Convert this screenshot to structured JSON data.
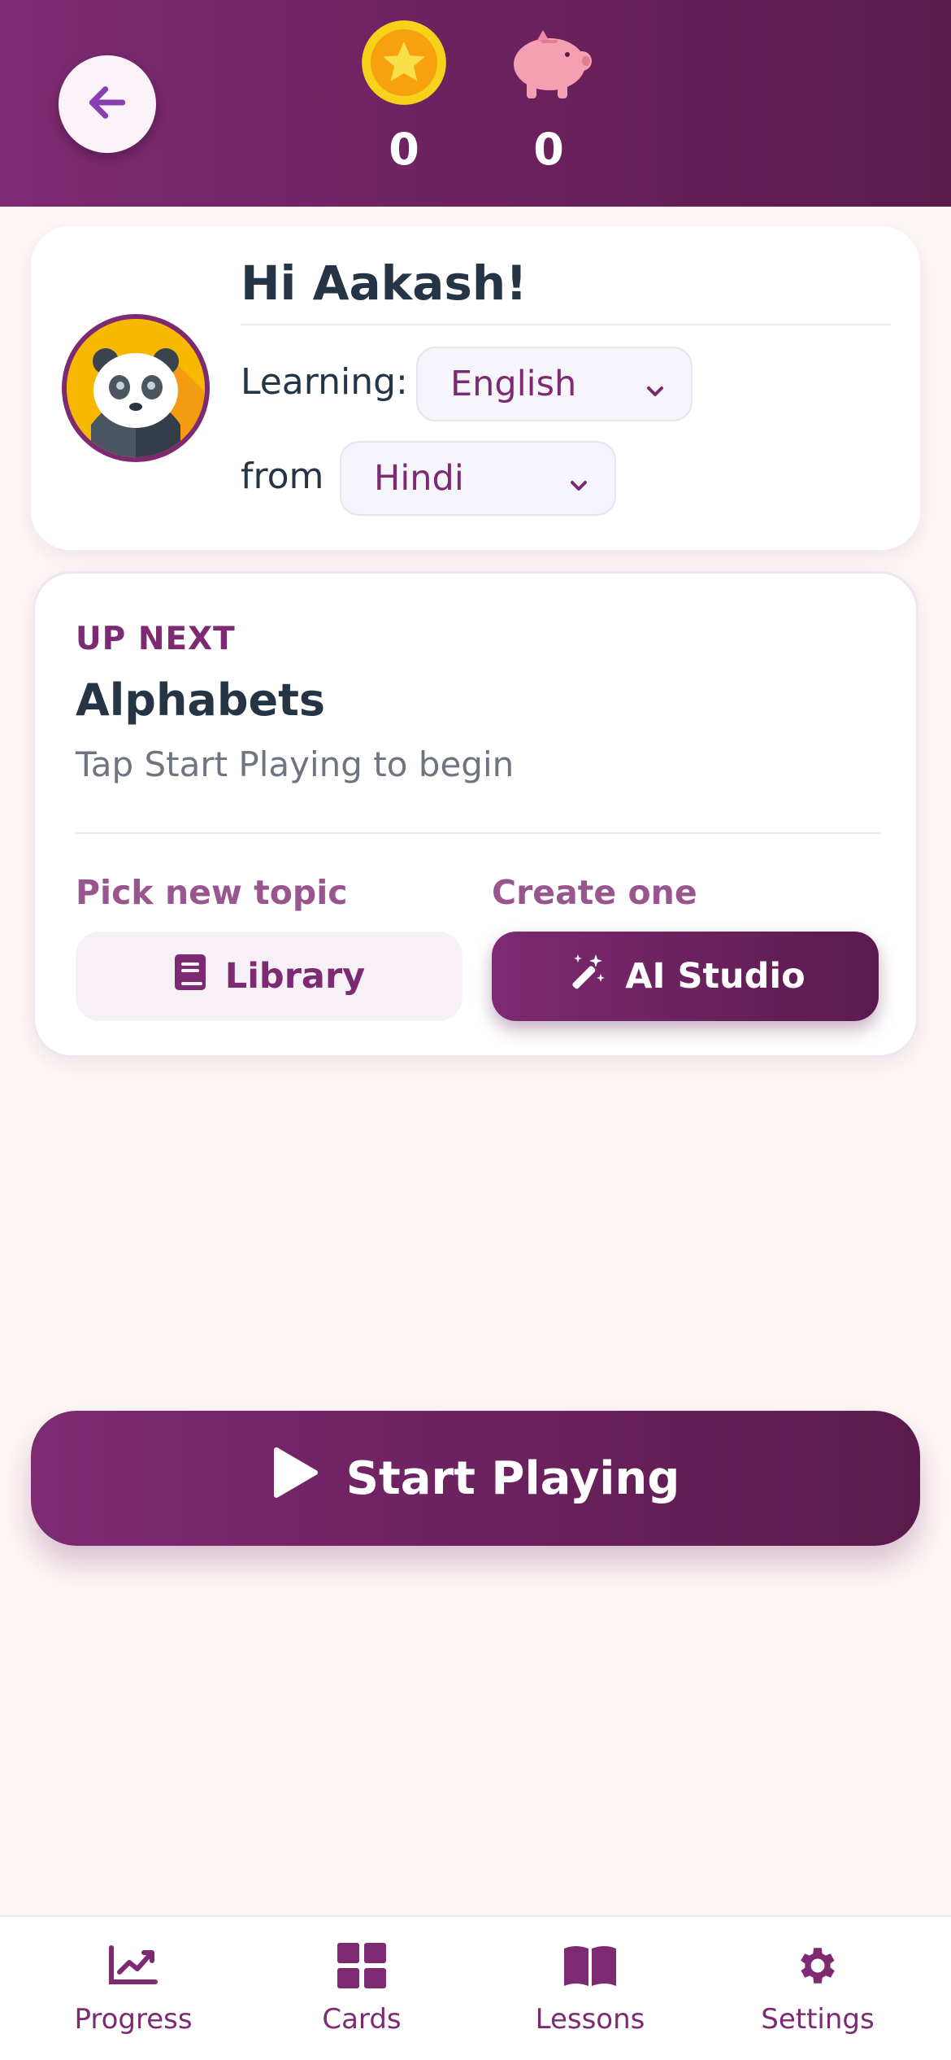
{
  "header": {
    "back_icon": "arrow-left-icon",
    "coins": {
      "icon": "star-coin-icon",
      "value": "0"
    },
    "savings": {
      "icon": "piggy-bank-icon",
      "value": "0"
    }
  },
  "profile": {
    "avatar_icon": "panda-avatar",
    "greeting": "Hi Aakash!",
    "learning_label": "Learning:",
    "learning_value": "English",
    "from_label": "from",
    "from_value": "Hindi"
  },
  "up_next": {
    "tag": "UP NEXT",
    "title": "Alphabets",
    "subtitle": "Tap Start Playing to begin",
    "pick_label": "Pick new topic",
    "create_label": "Create one",
    "library_button": "Library",
    "ai_button": "AI Studio"
  },
  "start_button": "Start Playing",
  "nav": [
    {
      "label": "Progress",
      "icon": "chart-line-icon"
    },
    {
      "label": "Cards",
      "icon": "grid-icon"
    },
    {
      "label": "Lessons",
      "icon": "book-open-icon"
    },
    {
      "label": "Settings",
      "icon": "gear-icon"
    }
  ],
  "colors": {
    "brand": "#7d2a72",
    "brand_dark": "#5b1a4c",
    "background": "#fdf8f5",
    "text": "#253545"
  }
}
